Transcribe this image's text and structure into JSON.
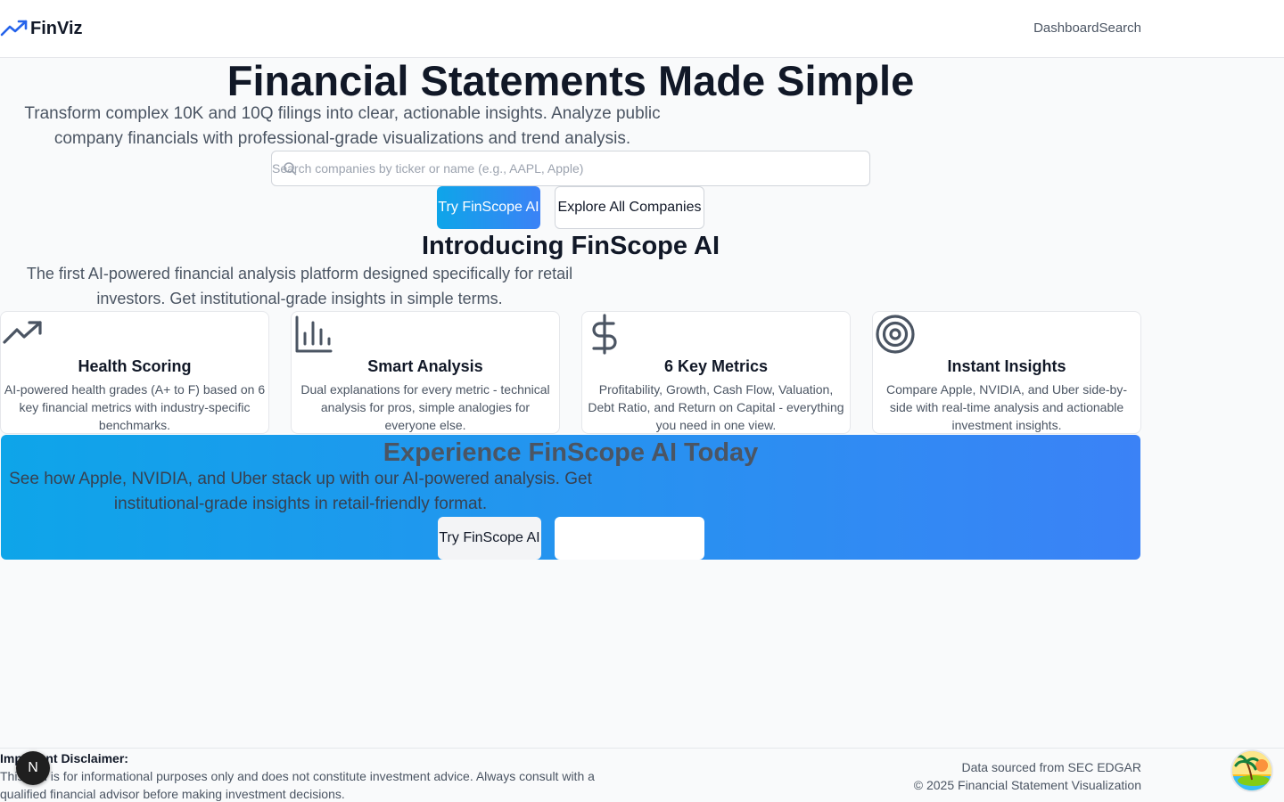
{
  "header": {
    "brand": "FinViz",
    "nav": [
      "Dashboard",
      "Search"
    ]
  },
  "hero": {
    "title": "Financial Statements Made Simple",
    "subtitle": "Transform complex 10K and 10Q filings into clear, actionable insights. Analyze public company financials with professional-grade visualizations and trend analysis.",
    "search_placeholder": "Search companies by ticker or name (e.g., AAPL, Apple)",
    "primary_button": "Try FinScope AI",
    "secondary_button": "Explore All Companies"
  },
  "intro": {
    "title": "Introducing FinScope AI",
    "subtitle": "The first AI-powered financial analysis platform designed specifically for retail investors. Get institutional-grade insights in simple terms."
  },
  "features": [
    {
      "icon": "trending-up-icon",
      "title": "Health Scoring",
      "description": "AI-powered health grades (A+ to F) based on 6 key financial metrics with industry-specific benchmarks."
    },
    {
      "icon": "bar-chart-icon",
      "title": "Smart Analysis",
      "description": "Dual explanations for every metric - technical analysis for pros, simple analogies for everyone else."
    },
    {
      "icon": "dollar-icon",
      "title": "6 Key Metrics",
      "description": "Profitability, Growth, Cash Flow, Valuation, Debt Ratio, and Return on Capital - everything you need in one view."
    },
    {
      "icon": "target-icon",
      "title": "Instant Insights",
      "description": "Compare Apple, NVIDIA, and Uber side-by-side with real-time analysis and actionable investment insights."
    }
  ],
  "cta": {
    "title": "Experience FinScope AI Today",
    "subtitle": "See how Apple, NVIDIA, and Uber stack up with our AI-powered analysis. Get institutional-grade insights in retail-friendly format.",
    "button": "Try FinScope AI"
  },
  "footer": {
    "disclaimer_title": "Important Disclaimer:",
    "disclaimer_text": "This tool is for informational purposes only and does not constitute investment advice. Always consult with a qualified financial advisor before making investment decisions.",
    "source": "Data sourced from SEC EDGAR",
    "copyright": "© 2025 Financial Statement Visualization"
  },
  "dev_badge": "N",
  "colors": {
    "accent_start": "#0ea5e9",
    "accent_end": "#3b82f6",
    "brand_icon": "#2563eb"
  }
}
